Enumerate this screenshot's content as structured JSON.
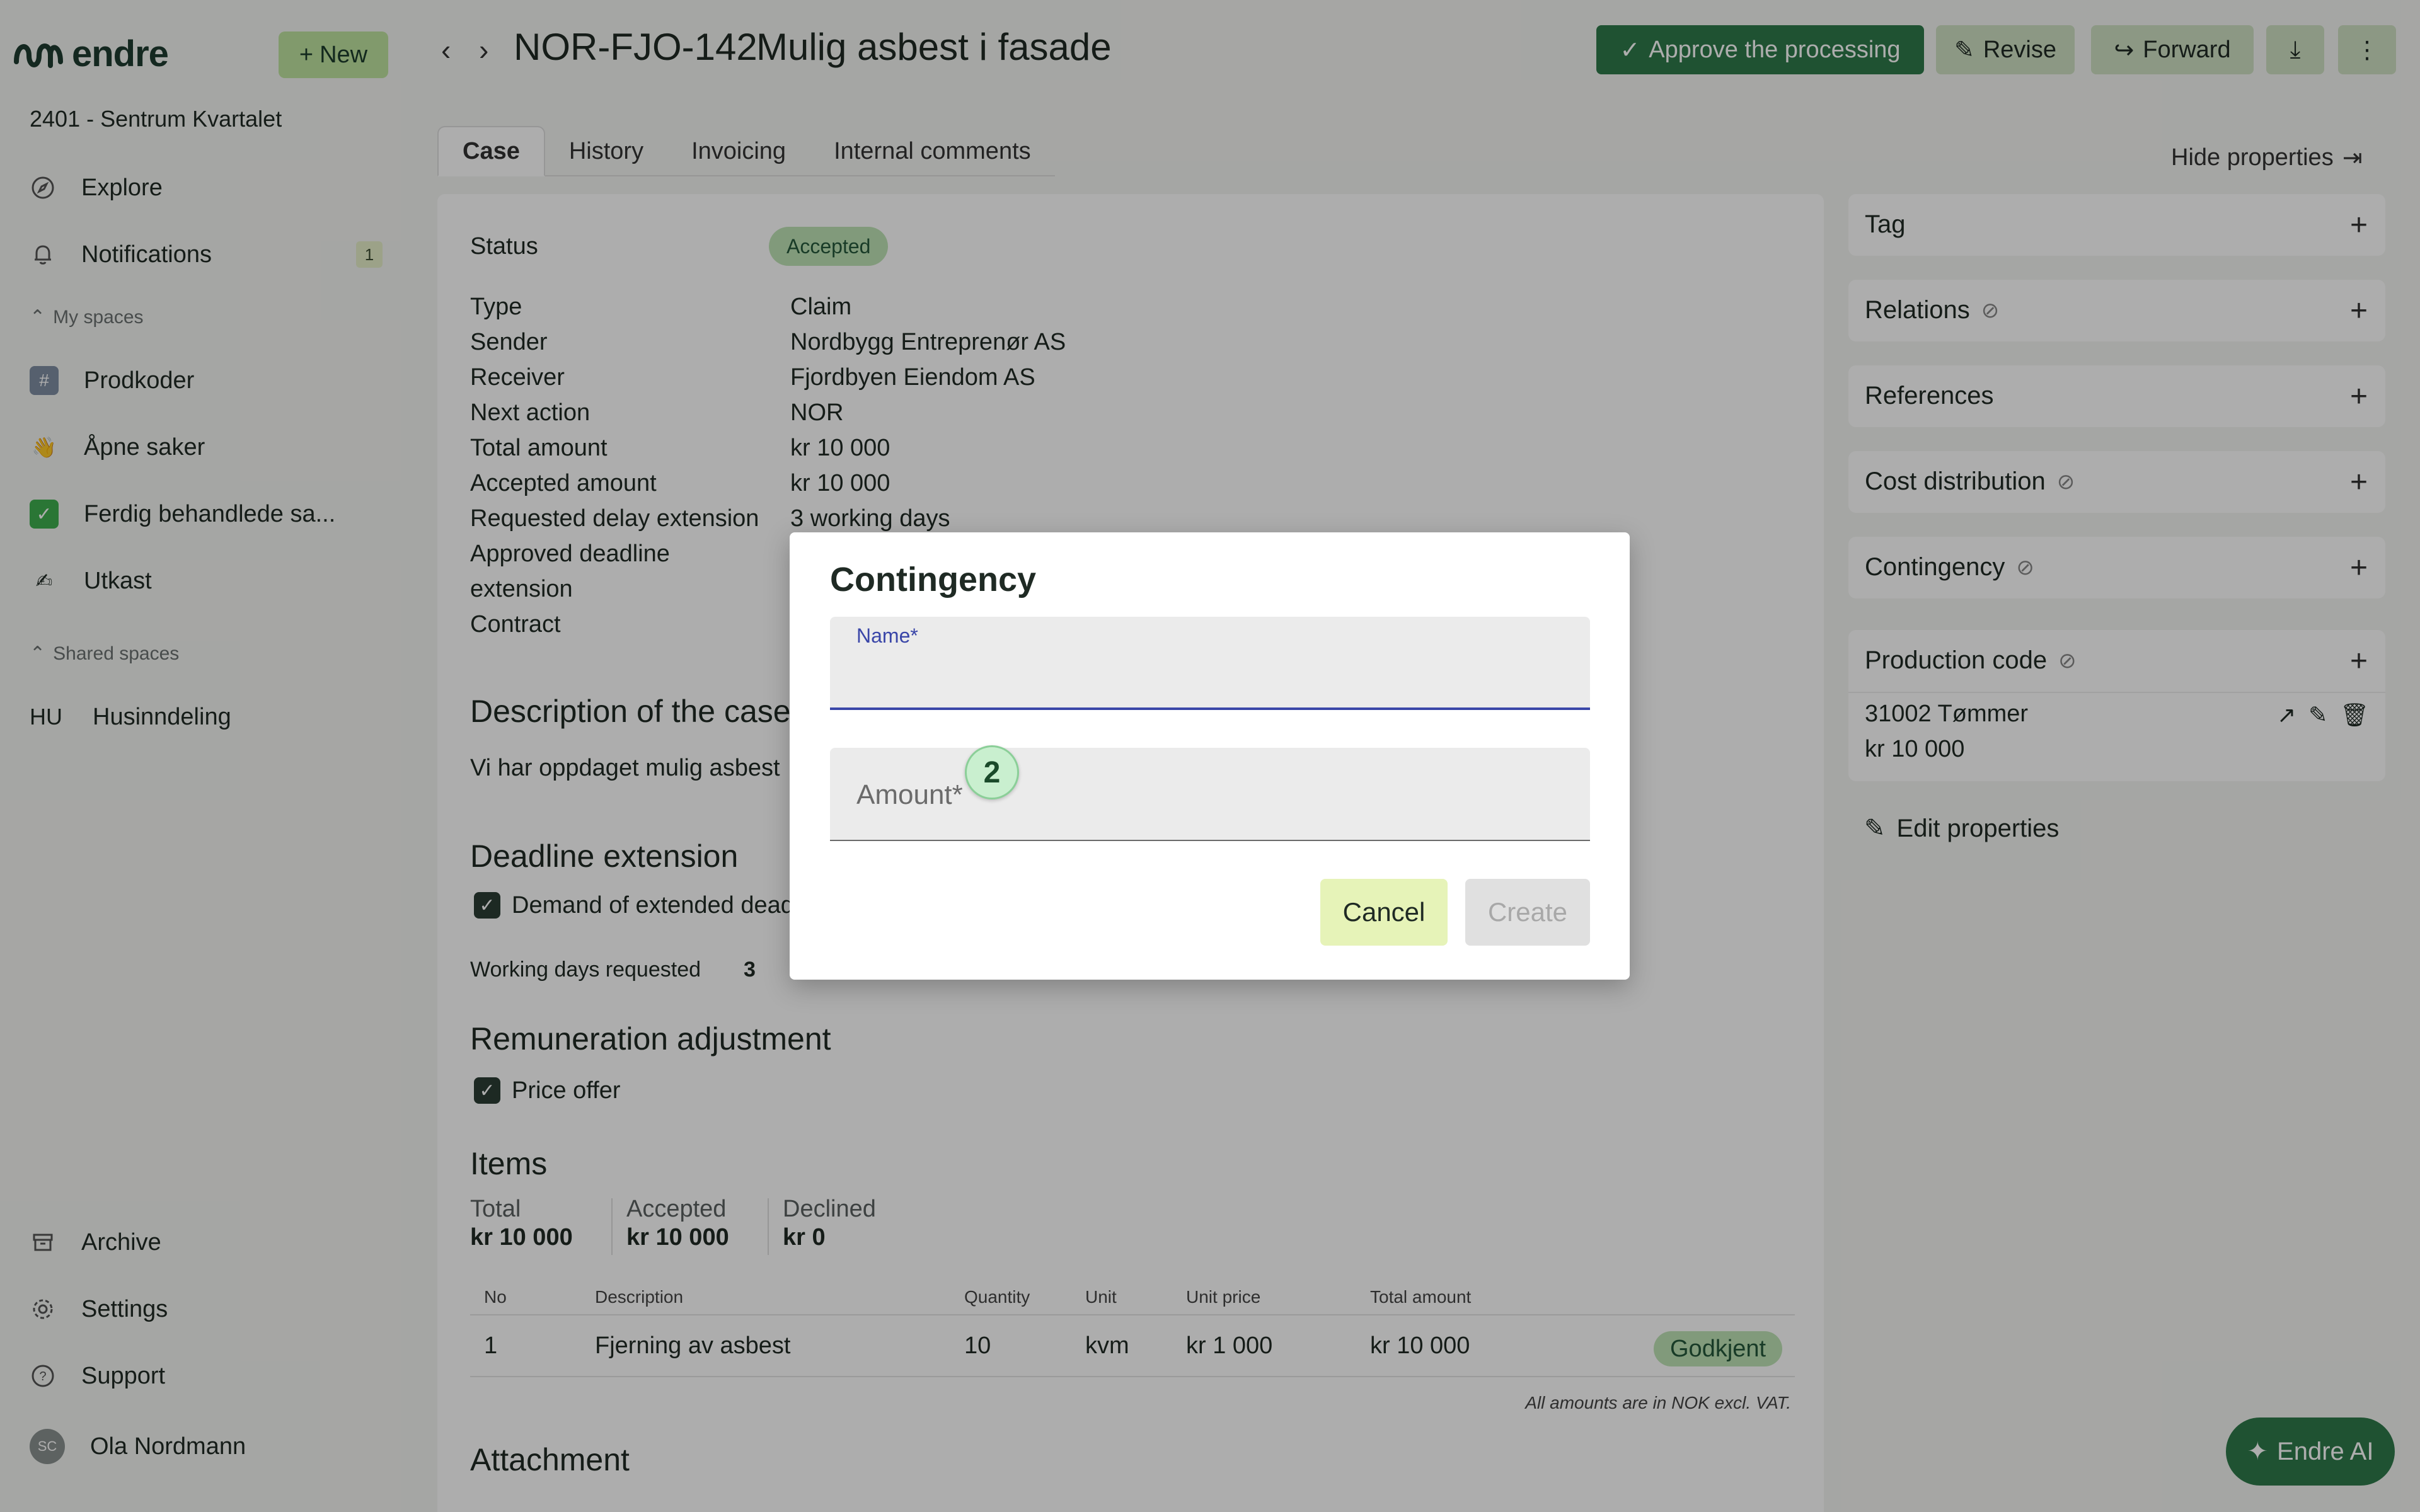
{
  "app": {
    "brand": "endre",
    "new_label": "New",
    "project": "2401 - Sentrum Kvartalet"
  },
  "sidebar": {
    "nav": [
      {
        "label": "Explore",
        "icon": "compass-icon"
      },
      {
        "label": "Notifications",
        "icon": "bell-icon",
        "count": "1"
      }
    ],
    "my_spaces_label": "My spaces",
    "my_spaces": [
      {
        "label": "Prodkoder",
        "icon": "hash-icon"
      },
      {
        "label": "Åpne saker",
        "icon": "waving-hand-icon"
      },
      {
        "label": "Ferdig behandlede sa...",
        "icon": "check-box-icon"
      },
      {
        "label": "Utkast",
        "icon": "writing-hand-icon"
      }
    ],
    "shared_spaces_label": "Shared spaces",
    "shared_spaces": [
      {
        "prefix": "HU",
        "label": "Husinndeling"
      }
    ],
    "bottom": [
      {
        "label": "Archive",
        "icon": "archive-icon"
      },
      {
        "label": "Settings",
        "icon": "gear-icon"
      },
      {
        "label": "Support",
        "icon": "help-icon"
      }
    ],
    "user": {
      "initials": "SC",
      "name": "Ola Nordmann"
    }
  },
  "header": {
    "case_id": "NOR-FJO-142",
    "case_title": "Mulig asbest i fasade",
    "approve_label": "Approve the processing",
    "revise_label": "Revise",
    "forward_label": "Forward"
  },
  "tabs": [
    "Case",
    "History",
    "Invoicing",
    "Internal comments"
  ],
  "hide_properties_label": "Hide properties",
  "case": {
    "status_label": "Status",
    "status_value": "Accepted",
    "fields": [
      {
        "label": "Type",
        "value": "Claim"
      },
      {
        "label": "Sender",
        "value": "Nordbygg Entreprenør AS"
      },
      {
        "label": "Receiver",
        "value": "Fjordbyen Eiendom AS"
      },
      {
        "label": "Next action",
        "value": "NOR"
      },
      {
        "label": "Total amount",
        "value": "kr 10 000"
      },
      {
        "label": "Accepted amount",
        "value": "kr 10 000"
      },
      {
        "label": "Requested delay extension",
        "value": "3 working days"
      },
      {
        "label": "Approved deadline",
        "value": ""
      },
      {
        "label": "extension",
        "value": ""
      },
      {
        "label": "Contract",
        "value": ""
      }
    ],
    "description_heading": "Description of the case",
    "description_text": "Vi har oppdaget mulig asbest",
    "deadline_heading": "Deadline extension",
    "deadline_check": "Demand of extended deadline",
    "working_days_label": "Working days requested",
    "working_days_value": "3",
    "remuneration_heading": "Remuneration adjustment",
    "price_offer": "Price offer",
    "items_heading": "Items",
    "totals": [
      {
        "label": "Total",
        "value": "kr 10 000"
      },
      {
        "label": "Accepted",
        "value": "kr 10 000"
      },
      {
        "label": "Declined",
        "value": "kr 0"
      }
    ],
    "table_headers": [
      "No",
      "Description",
      "Quantity",
      "Unit",
      "Unit price",
      "Total amount"
    ],
    "table_row": {
      "no": "1",
      "description": "Fjerning av asbest",
      "quantity": "10",
      "unit": "kvm",
      "unit_price": "kr 1 000",
      "total": "kr 10 000",
      "status": "Godkjent"
    },
    "amounts_note": "All amounts are in NOK excl. VAT.",
    "attachment_heading": "Attachment"
  },
  "properties": {
    "tag": "Tag",
    "relations": "Relations",
    "references": "References",
    "cost_distribution": "Cost distribution",
    "contingency": "Contingency",
    "production_code": "Production code",
    "production_item": "31002 Tømmer",
    "production_amount": "kr 10 000",
    "edit_label": "Edit properties"
  },
  "ai_label": "Endre AI",
  "modal": {
    "title": "Contingency",
    "name_label": "Name*",
    "amount_placeholder": "Amount*",
    "step": "2",
    "cancel_label": "Cancel",
    "create_label": "Create"
  }
}
